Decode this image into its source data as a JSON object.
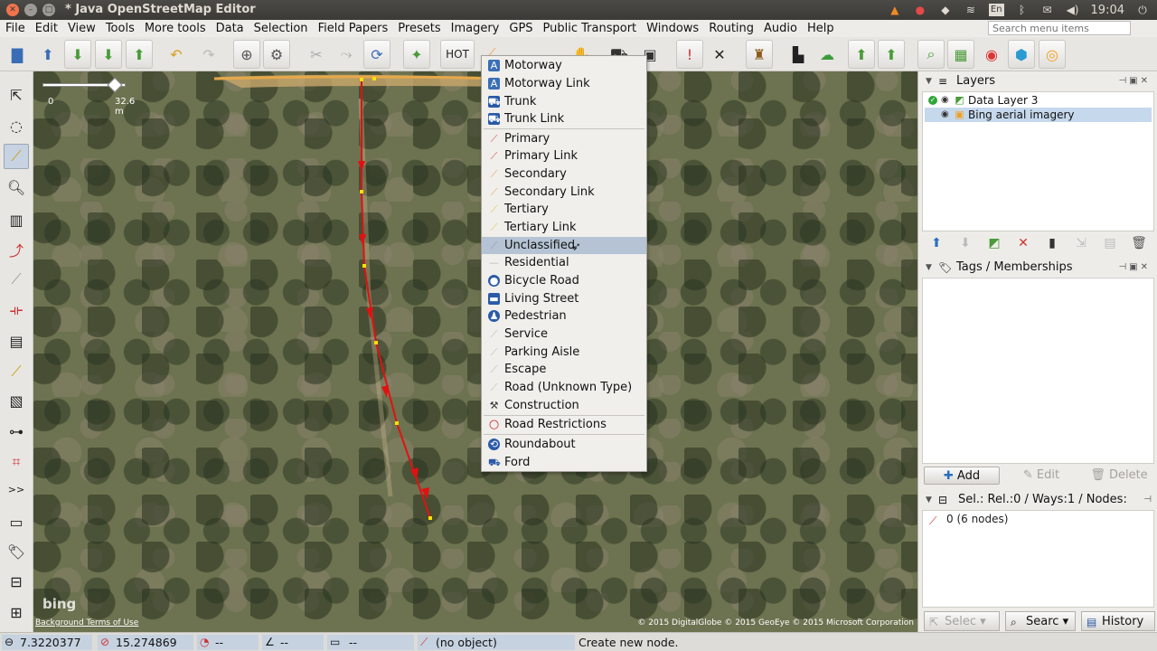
{
  "titlebar": {
    "title": "* Java OpenStreetMap Editor",
    "lang": "En",
    "clock": "19:04"
  },
  "menubar": {
    "items": [
      "File",
      "Edit",
      "View",
      "Tools",
      "More tools",
      "Data",
      "Selection",
      "Field Papers",
      "Presets",
      "Imagery",
      "GPS",
      "Public Transport",
      "Windows",
      "Routing",
      "Audio",
      "Help"
    ],
    "search_placeholder": "Search menu items"
  },
  "toolbar": {
    "hot_label": "HOT"
  },
  "map": {
    "scale_start": "0",
    "scale_end": "32.6 m",
    "bing_logo": "bing",
    "background_terms": "Background Terms of Use",
    "attribution": "© 2015 DigitalGlobe © 2015 GeoEye © 2015 Microsoft Corporation"
  },
  "highway_menu": {
    "items": [
      {
        "label": "Motorway",
        "icon": "motorway-icon",
        "color": "#3b6fb6"
      },
      {
        "label": "Motorway Link",
        "icon": "motorway-link-icon",
        "color": "#3b6fb6"
      },
      {
        "label": "Trunk",
        "icon": "trunk-icon",
        "color": "#2a5aa8"
      },
      {
        "label": "Trunk Link",
        "icon": "trunk-link-icon",
        "color": "#2a5aa8"
      },
      {
        "label": "Primary",
        "icon": "primary-icon",
        "color": "#d9534f"
      },
      {
        "label": "Primary Link",
        "icon": "primary-link-icon",
        "color": "#d9534f"
      },
      {
        "label": "Secondary",
        "icon": "secondary-icon",
        "color": "#f0a35a"
      },
      {
        "label": "Secondary Link",
        "icon": "secondary-link-icon",
        "color": "#f0a35a"
      },
      {
        "label": "Tertiary",
        "icon": "tertiary-icon",
        "color": "#f3dd6a"
      },
      {
        "label": "Tertiary Link",
        "icon": "tertiary-link-icon",
        "color": "#f3dd6a"
      },
      {
        "label": "Unclassified",
        "icon": "unclassified-icon",
        "color": "#999999"
      },
      {
        "label": "Residential",
        "icon": "residential-icon",
        "color": "#bbbbbb"
      },
      {
        "label": "Bicycle Road",
        "icon": "bicycle-road-icon",
        "color": "#2a5aa8"
      },
      {
        "label": "Living Street",
        "icon": "living-street-icon",
        "color": "#2a5aa8"
      },
      {
        "label": "Pedestrian",
        "icon": "pedestrian-icon",
        "color": "#2a5aa8"
      },
      {
        "label": "Service",
        "icon": "service-icon",
        "color": "#bbbbbb"
      },
      {
        "label": "Parking Aisle",
        "icon": "parking-aisle-icon",
        "color": "#bbbbbb"
      },
      {
        "label": "Escape",
        "icon": "escape-icon",
        "color": "#bbbbbb"
      },
      {
        "label": "Road (Unknown Type)",
        "icon": "road-unknown-icon",
        "color": "#bbbbbb"
      },
      {
        "label": "Construction",
        "icon": "construction-icon",
        "color": "#333333"
      },
      {
        "label": "Road Restrictions",
        "icon": "road-restrictions-icon",
        "color": "#cc2222"
      },
      {
        "label": "Roundabout",
        "icon": "roundabout-icon",
        "color": "#2a5aa8"
      },
      {
        "label": "Ford",
        "icon": "ford-icon",
        "color": "#2a5aa8"
      }
    ],
    "highlighted": "Unclassified"
  },
  "layers_panel": {
    "title": "Layers",
    "layers": [
      {
        "name": "Data Layer 3",
        "active": true
      },
      {
        "name": "Bing aerial imagery",
        "selected": true
      }
    ]
  },
  "tags_panel": {
    "title": "Tags / Memberships",
    "add_label": "Add",
    "edit_label": "Edit",
    "delete_label": "Delete"
  },
  "selection_panel": {
    "title": "Sel.: Rel.:0 / Ways:1 / Nodes:",
    "item": "0 (6 nodes)",
    "select_label": "Selec",
    "search_label": "Searc",
    "history_label": "History"
  },
  "statusbar": {
    "lat": "7.3220377",
    "lon": "15.274869",
    "heading": "--",
    "angle": "--",
    "distance": "--",
    "object": "(no object)",
    "help": "Create new node."
  },
  "colors": {
    "accent": "#b5c3d4",
    "way": "#e01010",
    "status_field": "#c6d2e0"
  }
}
